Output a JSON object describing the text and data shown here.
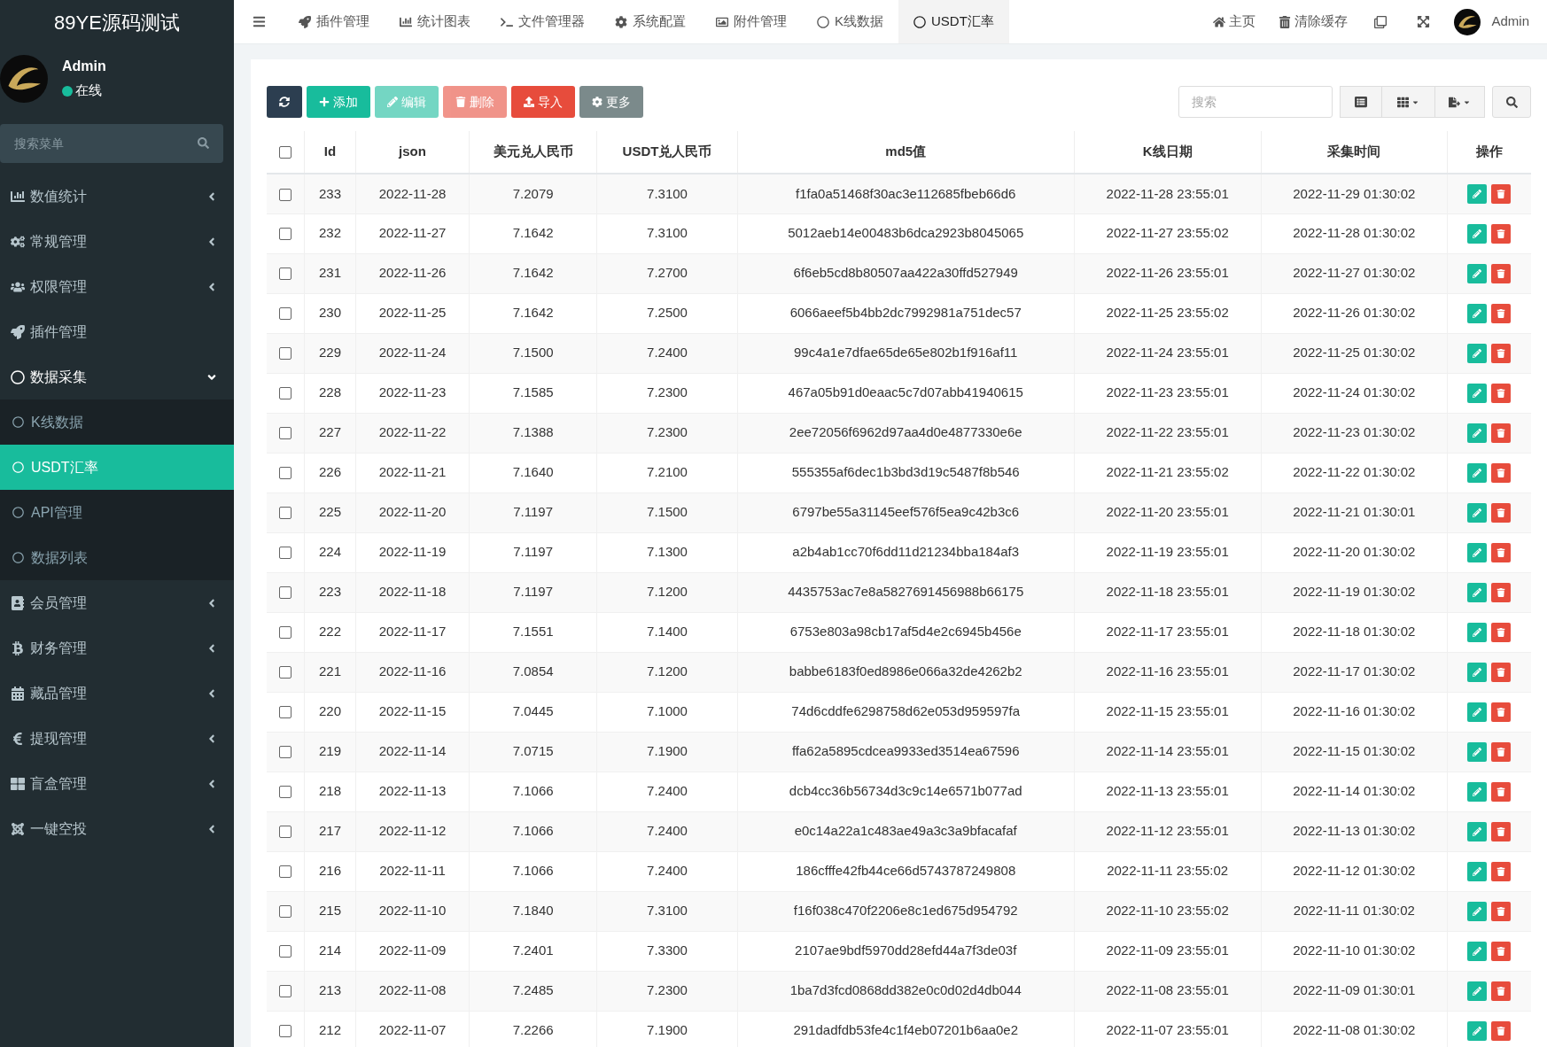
{
  "brand": "89YE源码测试",
  "user": {
    "name": "Admin",
    "status": "在线",
    "online": true
  },
  "menu_search": {
    "placeholder": "搜索菜单"
  },
  "sidebar": {
    "items": [
      {
        "label": "数值统计",
        "kind": "group",
        "expanded": false,
        "selected": false
      },
      {
        "label": "常规管理",
        "kind": "group",
        "expanded": false,
        "selected": false
      },
      {
        "label": "权限管理",
        "kind": "group",
        "expanded": false,
        "selected": false
      },
      {
        "label": "插件管理",
        "kind": "link",
        "selected": false
      },
      {
        "label": "数据采集",
        "kind": "group",
        "expanded": true,
        "selected": false,
        "children": [
          {
            "label": "K线数据",
            "selected": false
          },
          {
            "label": "USDT汇率",
            "selected": true
          },
          {
            "label": "API管理",
            "selected": false
          },
          {
            "label": "数据列表",
            "selected": false
          }
        ]
      },
      {
        "label": "会员管理",
        "kind": "group",
        "expanded": false,
        "selected": false
      },
      {
        "label": "财务管理",
        "kind": "group",
        "expanded": false,
        "selected": false
      },
      {
        "label": "藏品管理",
        "kind": "group",
        "expanded": false,
        "selected": false
      },
      {
        "label": "提现管理",
        "kind": "group",
        "expanded": false,
        "selected": false
      },
      {
        "label": "盲盒管理",
        "kind": "group",
        "expanded": false,
        "selected": false
      },
      {
        "label": "一键空投",
        "kind": "group",
        "expanded": false,
        "selected": false
      }
    ]
  },
  "tabs": [
    {
      "label": "插件管理",
      "selected": false
    },
    {
      "label": "统计图表",
      "selected": false
    },
    {
      "label": "文件管理器",
      "selected": false
    },
    {
      "label": "系统配置",
      "selected": false
    },
    {
      "label": "附件管理",
      "selected": false
    },
    {
      "label": "K线数据",
      "selected": false
    },
    {
      "label": "USDT汇率",
      "selected": true
    }
  ],
  "top_links": [
    {
      "label": "主页"
    },
    {
      "label": "清除缓存"
    }
  ],
  "top_user": "Admin",
  "toolbar": {
    "buttons": [
      {
        "kind": "refresh",
        "disabled": false
      },
      {
        "kind": "add",
        "label": "添加",
        "disabled": false
      },
      {
        "kind": "edit",
        "label": "编辑",
        "disabled": true
      },
      {
        "kind": "delete",
        "label": "删除",
        "disabled": true
      },
      {
        "kind": "import",
        "label": "导入",
        "disabled": false
      },
      {
        "kind": "more",
        "label": "更多",
        "disabled": false
      }
    ],
    "search": {
      "placeholder": "搜索"
    }
  },
  "table": {
    "header_checked": false,
    "columns": [
      "Id",
      "json",
      "美元兑人民币",
      "USDT兑人民币",
      "md5值",
      "K线日期",
      "采集时间",
      "操作"
    ],
    "rows": [
      {
        "checked": false,
        "cells": [
          "233",
          "2022-11-28",
          "7.2079",
          "7.3100",
          "f1fa0a51468f30ac3e112685fbeb66d6",
          "2022-11-28 23:55:01",
          "2022-11-29 01:30:02"
        ]
      },
      {
        "checked": false,
        "cells": [
          "232",
          "2022-11-27",
          "7.1642",
          "7.3100",
          "5012aeb14e00483b6dca2923b8045065",
          "2022-11-27 23:55:02",
          "2022-11-28 01:30:02"
        ]
      },
      {
        "checked": false,
        "cells": [
          "231",
          "2022-11-26",
          "7.1642",
          "7.2700",
          "6f6eb5cd8b80507aa422a30ffd527949",
          "2022-11-26 23:55:01",
          "2022-11-27 01:30:02"
        ]
      },
      {
        "checked": false,
        "cells": [
          "230",
          "2022-11-25",
          "7.1642",
          "7.2500",
          "6066aeef5b4bb2dc7992981a751dec57",
          "2022-11-25 23:55:02",
          "2022-11-26 01:30:02"
        ]
      },
      {
        "checked": false,
        "cells": [
          "229",
          "2022-11-24",
          "7.1500",
          "7.2400",
          "99c4a1e7dfae65de65e802b1f916af11",
          "2022-11-24 23:55:01",
          "2022-11-25 01:30:02"
        ]
      },
      {
        "checked": false,
        "cells": [
          "228",
          "2022-11-23",
          "7.1585",
          "7.2300",
          "467a05b91d0eaac5c7d07abb41940615",
          "2022-11-23 23:55:01",
          "2022-11-24 01:30:02"
        ]
      },
      {
        "checked": false,
        "cells": [
          "227",
          "2022-11-22",
          "7.1388",
          "7.2300",
          "2ee72056f6962d97aa4d0e4877330e6e",
          "2022-11-22 23:55:01",
          "2022-11-23 01:30:02"
        ]
      },
      {
        "checked": false,
        "cells": [
          "226",
          "2022-11-21",
          "7.1640",
          "7.2100",
          "555355af6dec1b3bd3d19c5487f8b546",
          "2022-11-21 23:55:02",
          "2022-11-22 01:30:02"
        ]
      },
      {
        "checked": false,
        "cells": [
          "225",
          "2022-11-20",
          "7.1197",
          "7.1500",
          "6797be55a31145eef576f5ea9c42b3c6",
          "2022-11-20 23:55:01",
          "2022-11-21 01:30:01"
        ]
      },
      {
        "checked": false,
        "cells": [
          "224",
          "2022-11-19",
          "7.1197",
          "7.1300",
          "a2b4ab1cc70f6dd11d21234bba184af3",
          "2022-11-19 23:55:01",
          "2022-11-20 01:30:02"
        ]
      },
      {
        "checked": false,
        "cells": [
          "223",
          "2022-11-18",
          "7.1197",
          "7.1200",
          "4435753ac7e8a5827691456988b66175",
          "2022-11-18 23:55:01",
          "2022-11-19 01:30:02"
        ]
      },
      {
        "checked": false,
        "cells": [
          "222",
          "2022-11-17",
          "7.1551",
          "7.1400",
          "6753e803a98cb17af5d4e2c6945b456e",
          "2022-11-17 23:55:01",
          "2022-11-18 01:30:02"
        ]
      },
      {
        "checked": false,
        "cells": [
          "221",
          "2022-11-16",
          "7.0854",
          "7.1200",
          "babbe6183f0ed8986e066a32de4262b2",
          "2022-11-16 23:55:01",
          "2022-11-17 01:30:02"
        ]
      },
      {
        "checked": false,
        "cells": [
          "220",
          "2022-11-15",
          "7.0445",
          "7.1000",
          "74d6cddfe6298758d62e053d959597fa",
          "2022-11-15 23:55:01",
          "2022-11-16 01:30:02"
        ]
      },
      {
        "checked": false,
        "cells": [
          "219",
          "2022-11-14",
          "7.0715",
          "7.1900",
          "ffa62a5895cdcea9933ed3514ea67596",
          "2022-11-14 23:55:01",
          "2022-11-15 01:30:02"
        ]
      },
      {
        "checked": false,
        "cells": [
          "218",
          "2022-11-13",
          "7.1066",
          "7.2400",
          "dcb4cc36b56734d3c9c14e6571b077ad",
          "2022-11-13 23:55:01",
          "2022-11-14 01:30:02"
        ]
      },
      {
        "checked": false,
        "cells": [
          "217",
          "2022-11-12",
          "7.1066",
          "7.2400",
          "e0c14a22a1c483ae49a3c3a9bfacafaf",
          "2022-11-12 23:55:01",
          "2022-11-13 01:30:02"
        ]
      },
      {
        "checked": false,
        "cells": [
          "216",
          "2022-11-11",
          "7.1066",
          "7.2400",
          "186cfffe42fb44ce66d5743787249808",
          "2022-11-11 23:55:02",
          "2022-11-12 01:30:02"
        ]
      },
      {
        "checked": false,
        "cells": [
          "215",
          "2022-11-10",
          "7.1840",
          "7.3100",
          "f16f038c470f2206e8c1ed675d954792",
          "2022-11-10 23:55:02",
          "2022-11-11 01:30:02"
        ]
      },
      {
        "checked": false,
        "cells": [
          "214",
          "2022-11-09",
          "7.2401",
          "7.3300",
          "2107ae9bdf5970dd28efd44a7f3de03f",
          "2022-11-09 23:55:01",
          "2022-11-10 01:30:02"
        ]
      },
      {
        "checked": false,
        "cells": [
          "213",
          "2022-11-08",
          "7.2485",
          "7.2300",
          "1ba7d3fcd0868dd382e0c0d02d4db044",
          "2022-11-08 23:55:01",
          "2022-11-09 01:30:01"
        ]
      },
      {
        "checked": false,
        "cells": [
          "212",
          "2022-11-07",
          "7.2266",
          "7.1900",
          "291dadfdb53fe4c1f4eb07201b6aa0e2",
          "2022-11-07 23:55:01",
          "2022-11-08 01:30:02"
        ]
      }
    ]
  }
}
